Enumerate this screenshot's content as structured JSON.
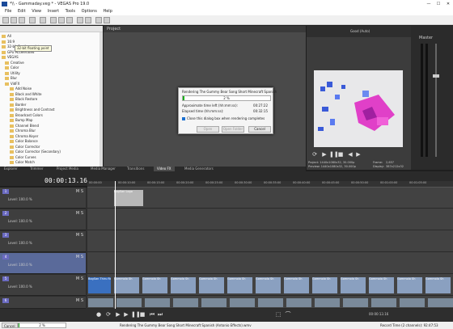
{
  "titlebar": {
    "title": "*\\\\ - Gammaday.veg * - VEGAS Pro 19.0",
    "min": "—",
    "max": "☐",
    "close": "✕"
  },
  "menu": [
    "File",
    "Edit",
    "View",
    "Insert",
    "Tools",
    "Options",
    "Help"
  ],
  "explorer": {
    "tooltip": "32-bit floating point",
    "items": [
      "All",
      "16:9",
      "32-bit floating point",
      "GPU Accelerated",
      "VEGAS",
      "Creative",
      "Color",
      "Utility",
      "Blur",
      "VidFX",
      "Add Noise",
      "Black and White",
      "Black Restore",
      "Border",
      "Brightness and Contrast",
      "Broadcast Colors",
      "Bump Map",
      "Channel Blend",
      "Chroma Blur",
      "Chroma Keyer",
      "Color Balance",
      "Color Corrector",
      "Color Corrector (Secondary)",
      "Color Curves",
      "Color Match"
    ]
  },
  "project_label": "Project",
  "dialog": {
    "title": "Rendering The Gummy Bear Song Short Minecraft Spanish",
    "percent": "2 %",
    "percent_value": 0.02,
    "approx_label": "Approximate time left (hh:mm:ss):",
    "approx_value": "00:27:22",
    "elapsed_label": "Elapsed time (hh:mm:ss):",
    "elapsed_value": "00:32:15",
    "checkbox_label": "Close this dialog box when rendering completes",
    "btn_open": "Open",
    "btn_folder": "Open Folder",
    "btn_cancel": "Cancel"
  },
  "preview": {
    "quality": "Good (Auto)",
    "project_line": "Project:   1440x1080x32, 30.000p",
    "preview_line": "Preview:   1440x1080x32, 30.000p",
    "frame_label": "Frame:",
    "frame_value": "2,657",
    "display_label": "Display:",
    "display_value": "387x212x32"
  },
  "master": {
    "label": "Master"
  },
  "tabs": [
    "Explorer",
    "Trimmer",
    "Project Media",
    "Media Manager",
    "Transitions",
    "Video FX",
    "Media Generators"
  ],
  "active_tab": "Video FX",
  "timeline": {
    "timecode": "00:00:13.16",
    "ticks": [
      "00:00:00",
      "00:00:10:00",
      "00:00:15:00",
      "00:00:20:00",
      "00:00:25:00",
      "00:00:30:00",
      "00:00:35:00",
      "00:00:40:00",
      "00:00:45:00",
      "00:00:50:00",
      "00:01:00:00",
      "00:01:05:00"
    ],
    "tracks": [
      {
        "num": "1",
        "level": "Level: 100.0 %"
      },
      {
        "num": "2",
        "level": "Level: 100.0 %"
      },
      {
        "num": "3",
        "level": "Level: 100.0 %"
      },
      {
        "num": "4",
        "level": "Level: 100.0 %"
      },
      {
        "num": "5",
        "level": "Level: 100.0 %"
      },
      {
        "num": "6",
        "level": ""
      }
    ],
    "clip_logo": "BogSan Logo",
    "clip_video": "BogSan Thiru Rq",
    "clip_repeat": "Gommolo Sh"
  },
  "transport": {
    "time_right": "00:00:13.16"
  },
  "status": {
    "cancel": "Cancel",
    "percent": "2 %",
    "message": "Rendering The Gummy Bear Song Short Minecraft Spanish (Antonio Effects).wmv",
    "record_time": "Record Time (2 channels): 92:47:53"
  },
  "colors": {
    "progress": "#1ab11a",
    "track_header": "#6a6ac0",
    "clip": "#8aa0c0"
  }
}
